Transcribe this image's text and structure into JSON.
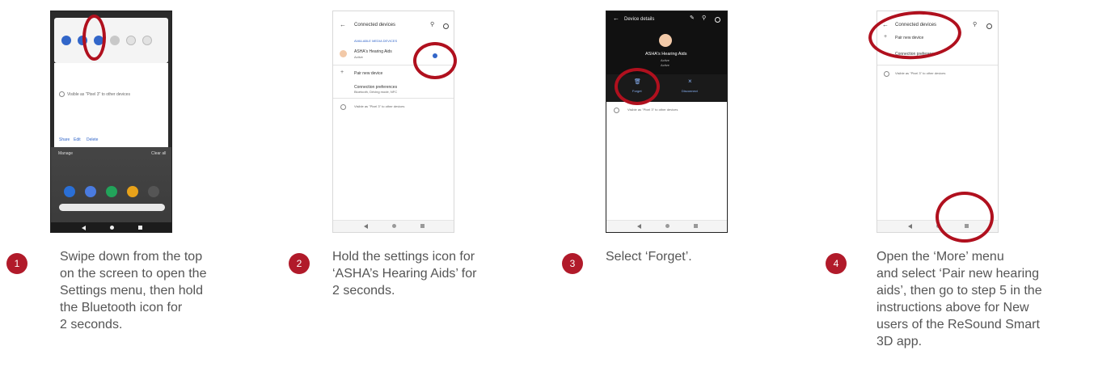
{
  "steps": [
    {
      "number": "1",
      "caption": [
        "Swipe down from the top",
        "on the screen to open the",
        "Settings menu, then hold",
        "the Bluetooth icon for",
        "2 seconds."
      ],
      "screen": {
        "visible_text": "Visible as \"Pixel 3\" to other devices",
        "share": "Share",
        "edit": "Edit",
        "delete": "Delete",
        "manage": "Manage",
        "clear_all": "Clear all",
        "app_colors": [
          "#2a6fd6",
          "#4a7be0",
          "#22a35a",
          "#e8a21a",
          "#333333"
        ]
      }
    },
    {
      "number": "2",
      "caption": [
        "Hold the settings icon for",
        "‘ASHA’s Hearing Aids’ for",
        "2 seconds."
      ],
      "screen": {
        "title": "Connected devices",
        "section": "AVAILABLE MEDIA DEVICES",
        "device_name": "ASHA's Hearing Aids",
        "device_status": "Active",
        "pair": "Pair new device",
        "prefs": "Connection preferences",
        "prefs_sub": "Bluetooth, Driving mode, NFC",
        "visible_text": "Visible as \"Pixel 3\" to other devices"
      }
    },
    {
      "number": "3",
      "caption": [
        "Select ‘Forget’."
      ],
      "screen": {
        "title": "Device details",
        "device_name": "ASHA's Hearing Aids",
        "status1": "Active",
        "status2": "Active",
        "forget": "Forget",
        "disconnect": "Disconnect",
        "visible_text": "Visible as \"Pixel 3\" to other devices"
      }
    },
    {
      "number": "4",
      "caption": [
        "Open the ‘More’ menu",
        "and select ‘Pair new hearing",
        "aids’, then go to step 5 in the",
        "instructions above for New",
        "users of the ReSound Smart",
        "3D app."
      ],
      "screen": {
        "title": "Connected devices",
        "pair": "Pair new device",
        "prefs": "Connection preferences",
        "visible_text": "Visible as \"Pixel 3\" to other devices"
      }
    }
  ],
  "colors": {
    "accent": "#b11a2a",
    "circle": "#b0101e",
    "caption": "#555555"
  }
}
